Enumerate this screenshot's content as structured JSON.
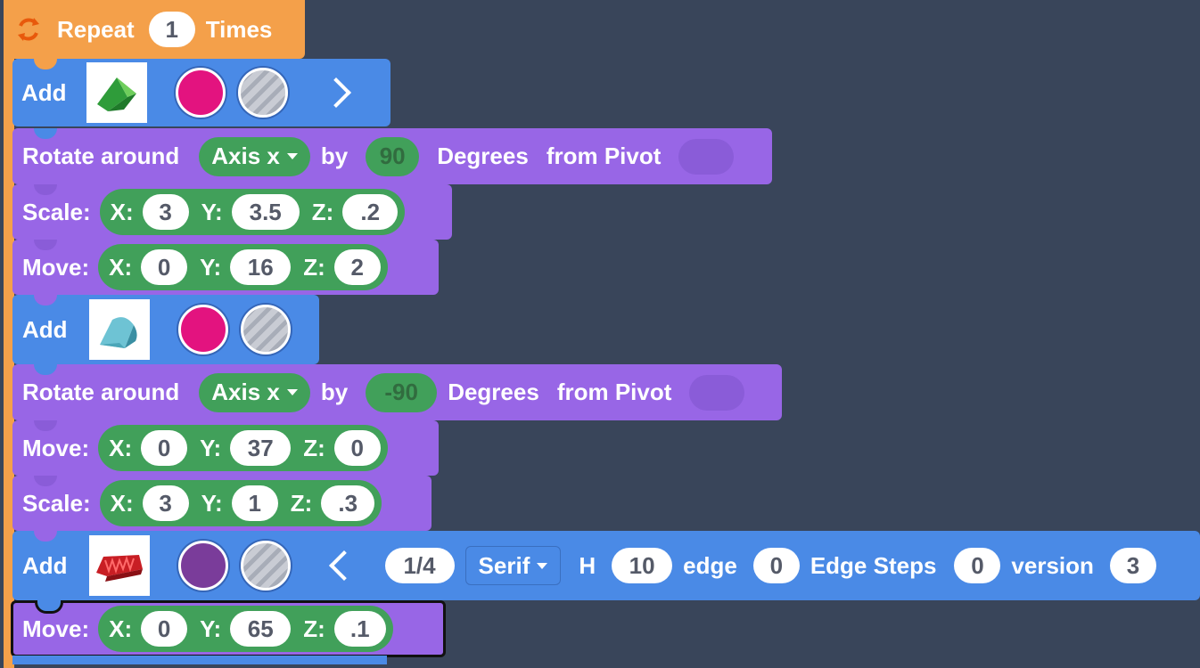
{
  "repeat": {
    "label": "Repeat",
    "count": "1",
    "suffix": "Times"
  },
  "block1": {
    "label": "Add",
    "color": "#e3137f",
    "shape": "triangular-prism"
  },
  "block2": {
    "label": "Rotate around",
    "axis": "Axis x",
    "by": "by",
    "value": "90",
    "degrees": "Degrees",
    "pivot": "from Pivot"
  },
  "block3": {
    "label": "Scale:",
    "x_label": "X:",
    "x": "3",
    "y_label": "Y:",
    "y": "3.5",
    "z_label": "Z:",
    "z": ".2"
  },
  "block4": {
    "label": "Move:",
    "x_label": "X:",
    "x": "0",
    "y_label": "Y:",
    "y": "16",
    "z_label": "Z:",
    "z": "2"
  },
  "block5": {
    "label": "Add",
    "color": "#e3137f",
    "shape": "half-cylinder"
  },
  "block6": {
    "label": "Rotate around",
    "axis": "Axis x",
    "by": "by",
    "value": "-90",
    "degrees": "Degrees",
    "pivot": "from Pivot"
  },
  "block7": {
    "label": "Move:",
    "x_label": "X:",
    "x": "0",
    "y_label": "Y:",
    "y": "37",
    "z_label": "Z:",
    "z": "0"
  },
  "block8": {
    "label": "Scale:",
    "x_label": "X:",
    "x": "3",
    "y_label": "Y:",
    "y": "1",
    "z_label": "Z:",
    "z": ".3"
  },
  "block9": {
    "label": "Add",
    "color": "#7a3c9a",
    "shape": "text-3d",
    "fraction": "1/4",
    "font": "Serif",
    "h_label": "H",
    "h": "10",
    "edge_label": "edge",
    "edge": "0",
    "edge_steps_label": "Edge Steps",
    "edge_steps": "0",
    "version_label": "version",
    "version": "3"
  },
  "block10": {
    "label": "Move:",
    "x_label": "X:",
    "x": "0",
    "y_label": "Y:",
    "y": "65",
    "z_label": "Z:",
    "z": ".1"
  },
  "colors": {
    "orange": "#f4a04a",
    "blue": "#4a8ae6",
    "purple": "#9866e6",
    "green": "#41a05a",
    "background": "#39455a"
  }
}
